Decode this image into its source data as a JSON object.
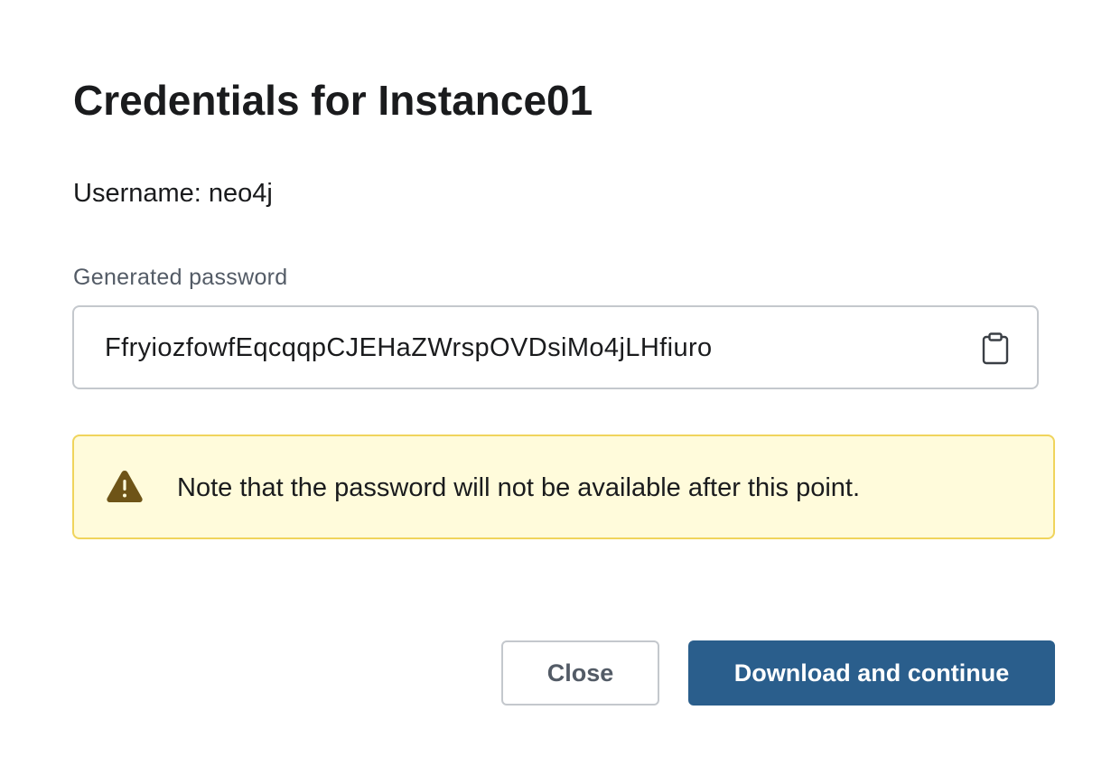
{
  "dialog": {
    "title": "Credentials for Instance01",
    "username_text": "Username: neo4j",
    "password_label": "Generated password",
    "password_value": "FfryiozfowfEqcqqpCJEHaZWrspOVDsiMo4jLHfiuro",
    "copy_icon": "clipboard-icon",
    "notice": {
      "icon": "warning-icon",
      "text": "Note that the password will not be available after this point.",
      "background": "#fffbdb",
      "border": "#f0d45c",
      "icon_color": "#6e5417"
    },
    "buttons": {
      "close_label": "Close",
      "primary_label": "Download and continue",
      "primary_color": "#2a5e8c"
    }
  }
}
